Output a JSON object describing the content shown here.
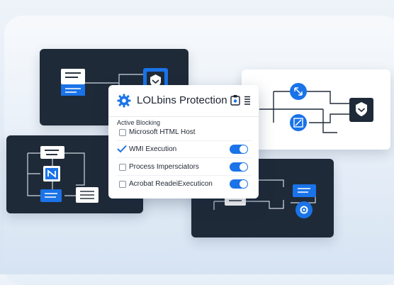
{
  "panel": {
    "title": "LOLbins Protection",
    "section_label": "Active Blocking",
    "rules": [
      {
        "label": "Microsoft HTML Host",
        "checked": false,
        "enabled": null
      },
      {
        "label": "WMI Execution",
        "checked": true,
        "enabled": true
      },
      {
        "label": "Process Impersciators",
        "checked": false,
        "enabled": true
      },
      {
        "label": "Acrobat ReadeiExecuticon",
        "checked": false,
        "enabled": true
      }
    ]
  },
  "icons": {
    "header": [
      "gear-icon",
      "clipboard-icon",
      "menu-icon"
    ],
    "workflow": [
      "document-icon",
      "shield-icon",
      "network-icon",
      "gear-node-icon"
    ]
  },
  "colors": {
    "accent": "#1a73e8",
    "dark_card": "#1f2a38",
    "background": "#e4edf7"
  }
}
